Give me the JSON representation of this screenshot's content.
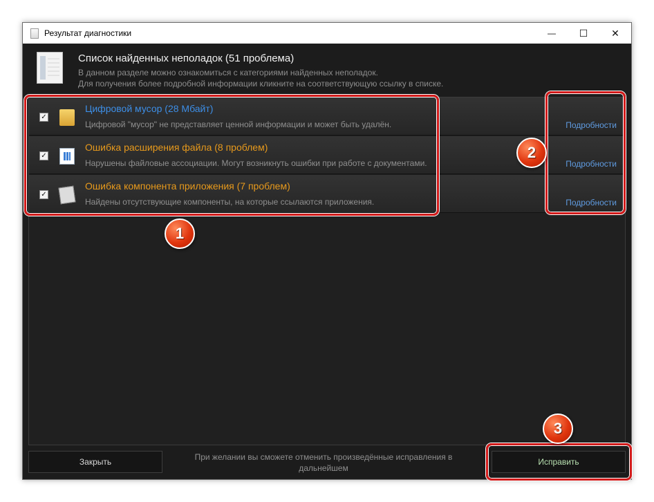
{
  "window": {
    "title": "Результат диагностики",
    "controls": {
      "minimize": "—",
      "maximize": "☐",
      "close": "✕"
    }
  },
  "header": {
    "title": "Список найденных неполадок (51 проблема)",
    "desc_line1": "В данном разделе можно ознакомиться с категориями найденных неполадок.",
    "desc_line2": "Для получения более подробной информации кликните на соответствующую ссылку в списке."
  },
  "items": [
    {
      "title": "Цифровой мусор (28 Мбайт)",
      "title_color": "#3d8ee6",
      "desc": "Цифровой \"мусор\" не представляет ценной информации и может быть удалён.",
      "link": "Подробности",
      "checked": true,
      "icon": "folder-icon"
    },
    {
      "title": "Ошибка расширения файла (8 проблем)",
      "title_color": "#e89a1c",
      "desc": "Нарушены файловые ассоциации. Могут возникнуть ошибки при работе с документами.",
      "link": "Подробности",
      "checked": true,
      "icon": "file-icon"
    },
    {
      "title": "Ошибка компонента приложения (7 проблем)",
      "title_color": "#e89a1c",
      "desc": "Найдены отсутствующие компоненты, на которые ссылаются приложения.",
      "link": "Подробности",
      "checked": true,
      "icon": "component-icon"
    }
  ],
  "footer": {
    "close_label": "Закрыть",
    "note": "При желании вы сможете отменить произведённые исправления в дальнейшем",
    "fix_label": "Исправить"
  },
  "annotations": {
    "badge1": "1",
    "badge2": "2",
    "badge3": "3",
    "highlight_color": "#d21a1a"
  }
}
